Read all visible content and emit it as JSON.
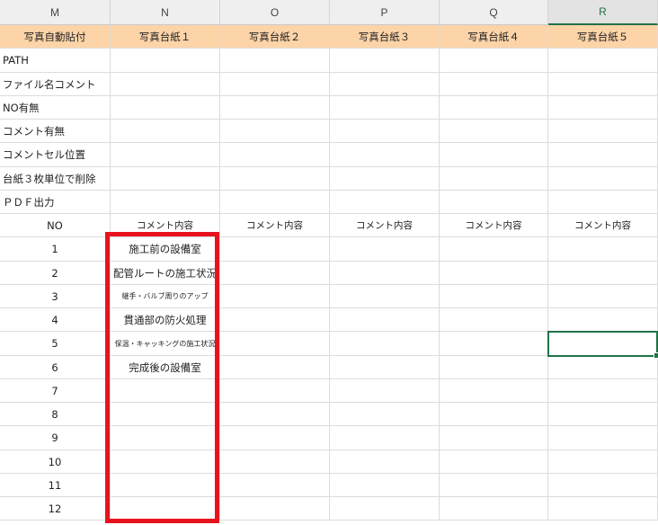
{
  "columns": [
    "M",
    "N",
    "O",
    "P",
    "Q",
    "R"
  ],
  "selected_column": "R",
  "header_row": [
    "写真自動貼付",
    "写真台紙１",
    "写真台紙２",
    "写真台紙３",
    "写真台紙４",
    "写真台紙５"
  ],
  "settings_rows": [
    "PATH",
    "ファイル名コメント",
    "NO有無",
    "コメント有無",
    "コメントセル位置",
    "台紙３枚単位で削除",
    "ＰＤＦ出力"
  ],
  "table_header": {
    "no_label": "NO",
    "comment_labels": [
      "コメント内容",
      "コメント内容",
      "コメント内容",
      "コメント内容",
      "コメント内容"
    ]
  },
  "rows": [
    {
      "no": "1",
      "comment": "施工前の設備室"
    },
    {
      "no": "2",
      "comment": "配管ルートの施工状況"
    },
    {
      "no": "3",
      "comment": "継手・バルブ周りのアップ"
    },
    {
      "no": "4",
      "comment": "貫通部の防火処理"
    },
    {
      "no": "5",
      "comment": "保温・キャッキングの施工状況"
    },
    {
      "no": "6",
      "comment": "完成後の設備室"
    },
    {
      "no": "7",
      "comment": ""
    },
    {
      "no": "8",
      "comment": ""
    },
    {
      "no": "9",
      "comment": ""
    },
    {
      "no": "10",
      "comment": ""
    },
    {
      "no": "11",
      "comment": ""
    },
    {
      "no": "12",
      "comment": ""
    }
  ],
  "colors": {
    "header_fill": "#fdd4a8",
    "highlight_border": "#e8121e",
    "active_cell_border": "#217346"
  }
}
